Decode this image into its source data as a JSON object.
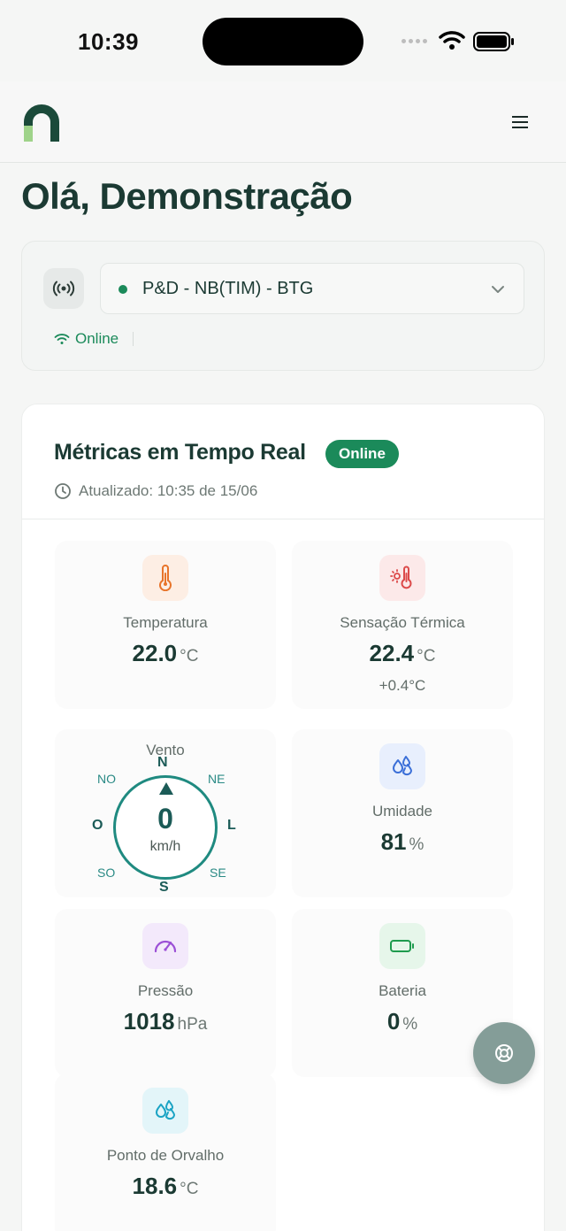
{
  "status_bar": {
    "time": "10:39"
  },
  "greeting": "Olá, Demonstração",
  "device": {
    "selected": "P&D - NB(TIM) - BTG",
    "status": "Online"
  },
  "metrics": {
    "title": "Métricas em Tempo Real",
    "badge": "Online",
    "updated": "Atualizado: 10:35 de 15/06",
    "temperature": {
      "label": "Temperatura",
      "value": "22.0",
      "unit": "°C"
    },
    "feels_like": {
      "label": "Sensação Térmica",
      "value": "22.4",
      "unit": "°C",
      "delta": "+0.4°C"
    },
    "wind": {
      "label": "Vento",
      "value": "0",
      "unit": "km/h",
      "directions": {
        "n": "N",
        "ne": "NE",
        "l": "L",
        "se": "SE",
        "s": "S",
        "so": "SO",
        "o": "O",
        "no": "NO"
      }
    },
    "humidity": {
      "label": "Umidade",
      "value": "81",
      "unit": "%"
    },
    "pressure": {
      "label": "Pressão",
      "value": "1018",
      "unit": "hPa"
    },
    "battery": {
      "label": "Bateria",
      "value": "0",
      "unit": "%"
    },
    "dew_point": {
      "label": "Ponto de Orvalho",
      "value": "18.6",
      "unit": "°C"
    }
  },
  "colors": {
    "brand_green": "#1b8a5a",
    "text_dark": "#1b3a33",
    "compass_teal": "#1f8a80",
    "fab": "#849d98"
  },
  "icons": {
    "temperature": "thermometer-icon",
    "feels_like": "thermometer-sun-icon",
    "humidity": "droplets-icon",
    "pressure": "gauge-icon",
    "battery": "battery-icon",
    "dew_point": "droplets-icon",
    "fab": "life-buoy-icon"
  }
}
